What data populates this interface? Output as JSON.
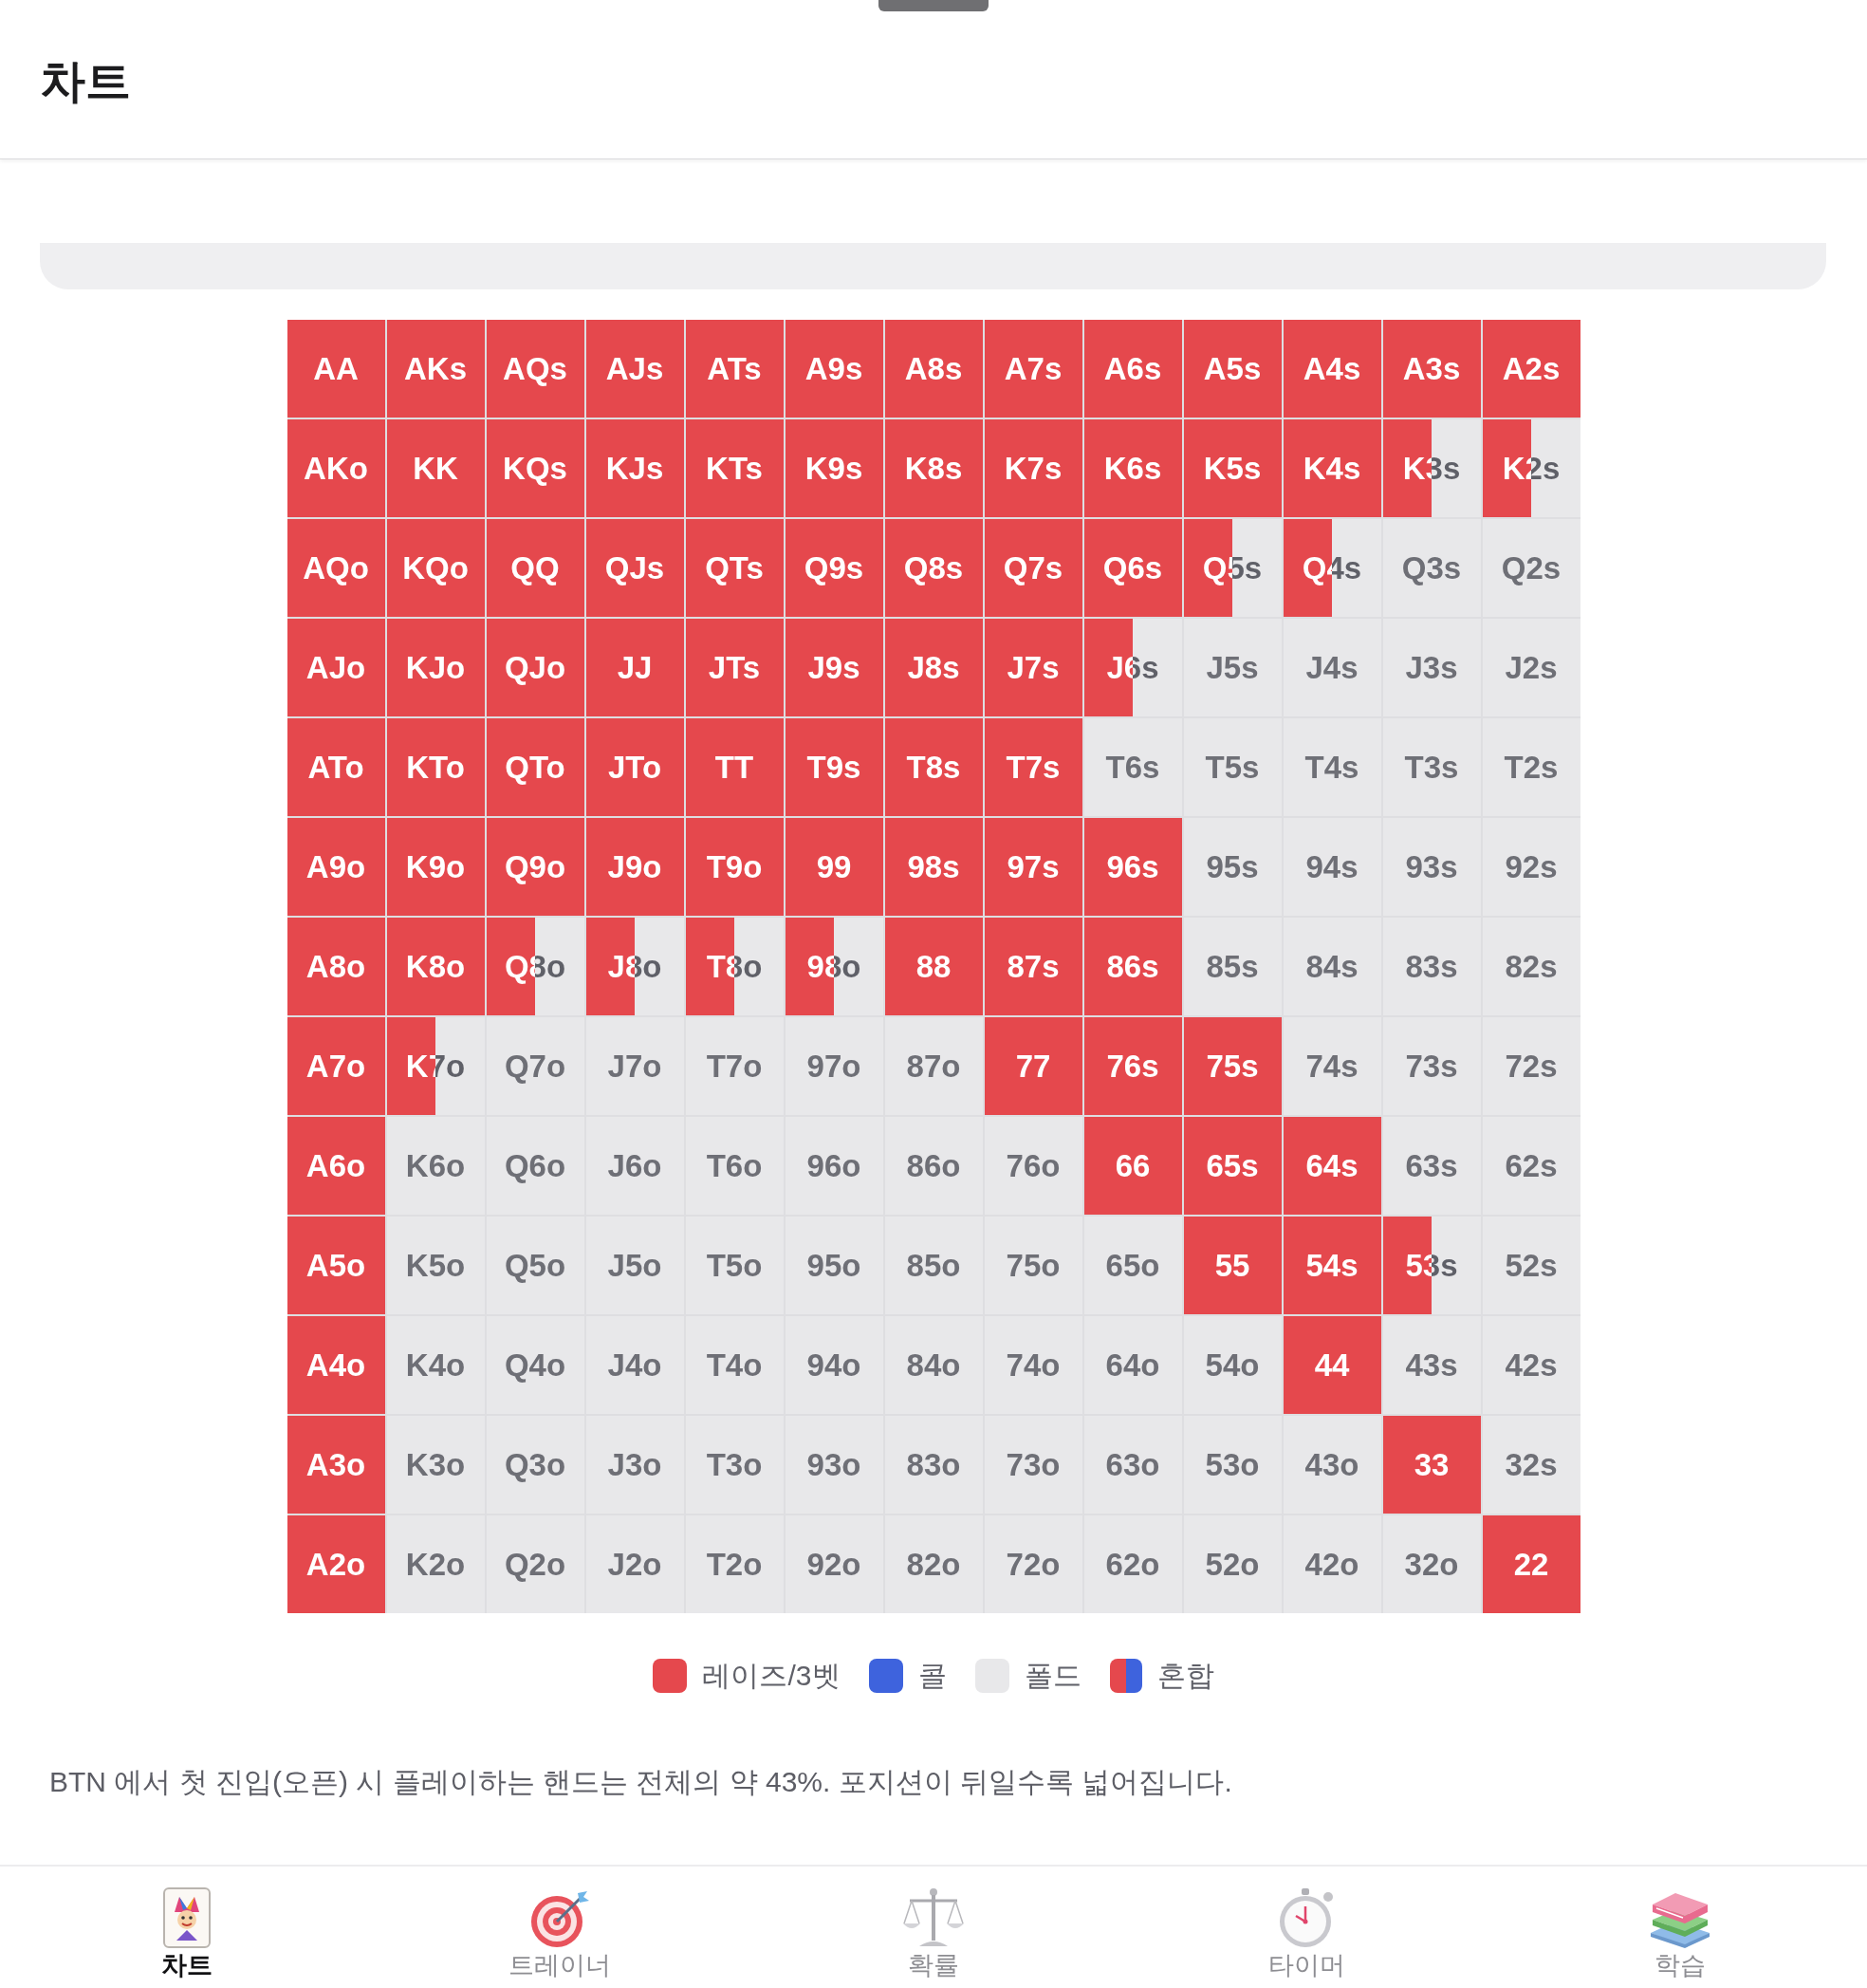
{
  "header": {
    "title": "차트"
  },
  "hand_grid": {
    "rows": [
      {
        "cells": [
          {
            "label": "AA",
            "kind": "raise"
          },
          {
            "label": "AKs",
            "kind": "raise"
          },
          {
            "label": "AQs",
            "kind": "raise"
          },
          {
            "label": "AJs",
            "kind": "raise"
          },
          {
            "label": "ATs",
            "kind": "raise"
          },
          {
            "label": "A9s",
            "kind": "raise"
          },
          {
            "label": "A8s",
            "kind": "raise"
          },
          {
            "label": "A7s",
            "kind": "raise"
          },
          {
            "label": "A6s",
            "kind": "raise"
          },
          {
            "label": "A5s",
            "kind": "raise"
          },
          {
            "label": "A4s",
            "kind": "raise"
          },
          {
            "label": "A3s",
            "kind": "raise"
          },
          {
            "label": "A2s",
            "kind": "raise"
          }
        ]
      },
      {
        "cells": [
          {
            "label": "AKo",
            "kind": "raise"
          },
          {
            "label": "KK",
            "kind": "raise"
          },
          {
            "label": "KQs",
            "kind": "raise"
          },
          {
            "label": "KJs",
            "kind": "raise"
          },
          {
            "label": "KTs",
            "kind": "raise"
          },
          {
            "label": "K9s",
            "kind": "raise"
          },
          {
            "label": "K8s",
            "kind": "raise"
          },
          {
            "label": "K7s",
            "kind": "raise"
          },
          {
            "label": "K6s",
            "kind": "raise"
          },
          {
            "label": "K5s",
            "kind": "raise"
          },
          {
            "label": "K4s",
            "kind": "raise"
          },
          {
            "label": "K3s",
            "kind": "mixed",
            "level": 0.5
          },
          {
            "label": "K2s",
            "kind": "mixed",
            "level": 0.5
          }
        ]
      },
      {
        "cells": [
          {
            "label": "AQo",
            "kind": "raise"
          },
          {
            "label": "KQo",
            "kind": "raise"
          },
          {
            "label": "QQ",
            "kind": "raise"
          },
          {
            "label": "QJs",
            "kind": "raise"
          },
          {
            "label": "QTs",
            "kind": "raise"
          },
          {
            "label": "Q9s",
            "kind": "raise"
          },
          {
            "label": "Q8s",
            "kind": "raise"
          },
          {
            "label": "Q7s",
            "kind": "raise"
          },
          {
            "label": "Q6s",
            "kind": "raise"
          },
          {
            "label": "Q5s",
            "kind": "mixed",
            "level": 0.5
          },
          {
            "label": "Q4s",
            "kind": "mixed",
            "level": 0.5
          },
          {
            "label": "Q3s",
            "kind": "fold"
          },
          {
            "label": "Q2s",
            "kind": "fold"
          }
        ]
      },
      {
        "cells": [
          {
            "label": "AJo",
            "kind": "raise"
          },
          {
            "label": "KJo",
            "kind": "raise"
          },
          {
            "label": "QJo",
            "kind": "raise"
          },
          {
            "label": "JJ",
            "kind": "raise"
          },
          {
            "label": "JTs",
            "kind": "raise"
          },
          {
            "label": "J9s",
            "kind": "raise"
          },
          {
            "label": "J8s",
            "kind": "raise"
          },
          {
            "label": "J7s",
            "kind": "raise"
          },
          {
            "label": "J6s",
            "kind": "mixed",
            "level": 0.5
          },
          {
            "label": "J5s",
            "kind": "fold"
          },
          {
            "label": "J4s",
            "kind": "fold"
          },
          {
            "label": "J3s",
            "kind": "fold"
          },
          {
            "label": "J2s",
            "kind": "fold"
          }
        ]
      },
      {
        "cells": [
          {
            "label": "ATo",
            "kind": "raise"
          },
          {
            "label": "KTo",
            "kind": "raise"
          },
          {
            "label": "QTo",
            "kind": "raise"
          },
          {
            "label": "JTo",
            "kind": "raise"
          },
          {
            "label": "TT",
            "kind": "raise"
          },
          {
            "label": "T9s",
            "kind": "raise"
          },
          {
            "label": "T8s",
            "kind": "raise"
          },
          {
            "label": "T7s",
            "kind": "raise"
          },
          {
            "label": "T6s",
            "kind": "fold"
          },
          {
            "label": "T5s",
            "kind": "fold"
          },
          {
            "label": "T4s",
            "kind": "fold"
          },
          {
            "label": "T3s",
            "kind": "fold"
          },
          {
            "label": "T2s",
            "kind": "fold"
          }
        ]
      },
      {
        "cells": [
          {
            "label": "A9o",
            "kind": "raise"
          },
          {
            "label": "K9o",
            "kind": "raise"
          },
          {
            "label": "Q9o",
            "kind": "raise"
          },
          {
            "label": "J9o",
            "kind": "raise"
          },
          {
            "label": "T9o",
            "kind": "raise"
          },
          {
            "label": "99",
            "kind": "raise"
          },
          {
            "label": "98s",
            "kind": "raise"
          },
          {
            "label": "97s",
            "kind": "raise"
          },
          {
            "label": "96s",
            "kind": "raise"
          },
          {
            "label": "95s",
            "kind": "fold"
          },
          {
            "label": "94s",
            "kind": "fold"
          },
          {
            "label": "93s",
            "kind": "fold"
          },
          {
            "label": "92s",
            "kind": "fold"
          }
        ]
      },
      {
        "cells": [
          {
            "label": "A8o",
            "kind": "raise"
          },
          {
            "label": "K8o",
            "kind": "raise"
          },
          {
            "label": "Q8o",
            "kind": "mixed",
            "level": 0.5
          },
          {
            "label": "J8o",
            "kind": "mixed",
            "level": 0.5
          },
          {
            "label": "T8o",
            "kind": "mixed",
            "level": 0.5
          },
          {
            "label": "98o",
            "kind": "mixed",
            "level": 0.5
          },
          {
            "label": "88",
            "kind": "raise"
          },
          {
            "label": "87s",
            "kind": "raise"
          },
          {
            "label": "86s",
            "kind": "raise"
          },
          {
            "label": "85s",
            "kind": "fold"
          },
          {
            "label": "84s",
            "kind": "fold"
          },
          {
            "label": "83s",
            "kind": "fold"
          },
          {
            "label": "82s",
            "kind": "fold"
          }
        ]
      },
      {
        "cells": [
          {
            "label": "A7o",
            "kind": "raise"
          },
          {
            "label": "K7o",
            "kind": "mixed",
            "level": 0.5
          },
          {
            "label": "Q7o",
            "kind": "fold"
          },
          {
            "label": "J7o",
            "kind": "fold"
          },
          {
            "label": "T7o",
            "kind": "fold"
          },
          {
            "label": "97o",
            "kind": "fold"
          },
          {
            "label": "87o",
            "kind": "fold"
          },
          {
            "label": "77",
            "kind": "raise"
          },
          {
            "label": "76s",
            "kind": "raise"
          },
          {
            "label": "75s",
            "kind": "raise"
          },
          {
            "label": "74s",
            "kind": "fold"
          },
          {
            "label": "73s",
            "kind": "fold"
          },
          {
            "label": "72s",
            "kind": "fold"
          }
        ]
      },
      {
        "cells": [
          {
            "label": "A6o",
            "kind": "raise"
          },
          {
            "label": "K6o",
            "kind": "fold"
          },
          {
            "label": "Q6o",
            "kind": "fold"
          },
          {
            "label": "J6o",
            "kind": "fold"
          },
          {
            "label": "T6o",
            "kind": "fold"
          },
          {
            "label": "96o",
            "kind": "fold"
          },
          {
            "label": "86o",
            "kind": "fold"
          },
          {
            "label": "76o",
            "kind": "fold"
          },
          {
            "label": "66",
            "kind": "raise"
          },
          {
            "label": "65s",
            "kind": "raise"
          },
          {
            "label": "64s",
            "kind": "raise"
          },
          {
            "label": "63s",
            "kind": "fold"
          },
          {
            "label": "62s",
            "kind": "fold"
          }
        ]
      },
      {
        "cells": [
          {
            "label": "A5o",
            "kind": "raise"
          },
          {
            "label": "K5o",
            "kind": "fold"
          },
          {
            "label": "Q5o",
            "kind": "fold"
          },
          {
            "label": "J5o",
            "kind": "fold"
          },
          {
            "label": "T5o",
            "kind": "fold"
          },
          {
            "label": "95o",
            "kind": "fold"
          },
          {
            "label": "85o",
            "kind": "fold"
          },
          {
            "label": "75o",
            "kind": "fold"
          },
          {
            "label": "65o",
            "kind": "fold"
          },
          {
            "label": "55",
            "kind": "raise"
          },
          {
            "label": "54s",
            "kind": "raise"
          },
          {
            "label": "53s",
            "kind": "mixed",
            "level": 0.5
          },
          {
            "label": "52s",
            "kind": "fold"
          }
        ]
      },
      {
        "cells": [
          {
            "label": "A4o",
            "kind": "raise"
          },
          {
            "label": "K4o",
            "kind": "fold"
          },
          {
            "label": "Q4o",
            "kind": "fold"
          },
          {
            "label": "J4o",
            "kind": "fold"
          },
          {
            "label": "T4o",
            "kind": "fold"
          },
          {
            "label": "94o",
            "kind": "fold"
          },
          {
            "label": "84o",
            "kind": "fold"
          },
          {
            "label": "74o",
            "kind": "fold"
          },
          {
            "label": "64o",
            "kind": "fold"
          },
          {
            "label": "54o",
            "kind": "fold"
          },
          {
            "label": "44",
            "kind": "raise"
          },
          {
            "label": "43s",
            "kind": "fold"
          },
          {
            "label": "42s",
            "kind": "fold"
          }
        ]
      },
      {
        "cells": [
          {
            "label": "A3o",
            "kind": "raise"
          },
          {
            "label": "K3o",
            "kind": "fold"
          },
          {
            "label": "Q3o",
            "kind": "fold"
          },
          {
            "label": "J3o",
            "kind": "fold"
          },
          {
            "label": "T3o",
            "kind": "fold"
          },
          {
            "label": "93o",
            "kind": "fold"
          },
          {
            "label": "83o",
            "kind": "fold"
          },
          {
            "label": "73o",
            "kind": "fold"
          },
          {
            "label": "63o",
            "kind": "fold"
          },
          {
            "label": "53o",
            "kind": "fold"
          },
          {
            "label": "43o",
            "kind": "fold"
          },
          {
            "label": "33",
            "kind": "raise"
          },
          {
            "label": "32s",
            "kind": "fold"
          }
        ]
      },
      {
        "cells": [
          {
            "label": "A2o",
            "kind": "raise"
          },
          {
            "label": "K2o",
            "kind": "fold"
          },
          {
            "label": "Q2o",
            "kind": "fold"
          },
          {
            "label": "J2o",
            "kind": "fold"
          },
          {
            "label": "T2o",
            "kind": "fold"
          },
          {
            "label": "92o",
            "kind": "fold"
          },
          {
            "label": "82o",
            "kind": "fold"
          },
          {
            "label": "72o",
            "kind": "fold"
          },
          {
            "label": "62o",
            "kind": "fold"
          },
          {
            "label": "52o",
            "kind": "fold"
          },
          {
            "label": "42o",
            "kind": "fold"
          },
          {
            "label": "32o",
            "kind": "fold"
          },
          {
            "label": "22",
            "kind": "raise"
          }
        ]
      }
    ]
  },
  "legend": [
    {
      "label": "레이즈/3벳",
      "kind": "raise",
      "color": "#e5484d"
    },
    {
      "label": "콜",
      "kind": "call",
      "color": "#3e63dd"
    },
    {
      "label": "폴드",
      "kind": "fold",
      "color": "#e8e8ea"
    },
    {
      "label": "혼합",
      "kind": "mixed"
    }
  ],
  "description": "BTN 에서 첫 진입(오픈) 시 플레이하는 핸드는 전체의 약 43%. 포지션이 뒤일수록 넓어집니다.",
  "tabs": [
    {
      "label": "차트",
      "kind": "card",
      "selected": true
    },
    {
      "label": "트레이너",
      "kind": "target",
      "selected": false
    },
    {
      "label": "확률",
      "kind": "scales",
      "selected": false
    },
    {
      "label": "타이머",
      "kind": "stopwatch",
      "selected": false
    },
    {
      "label": "학습",
      "kind": "books",
      "selected": false
    }
  ]
}
